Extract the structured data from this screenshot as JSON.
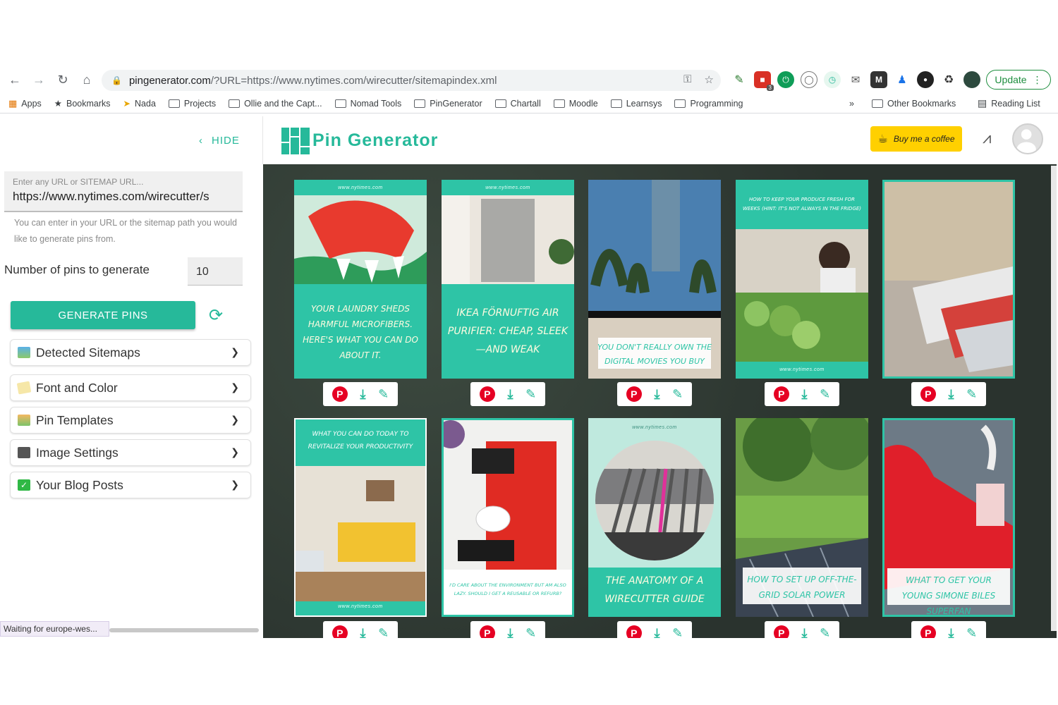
{
  "browser": {
    "url_host": "pingenerator.com",
    "url_rest": "/?URL=https://www.nytimes.com/wirecutter/sitemapindex.xml",
    "update_label": "Update",
    "extension_badge": "3",
    "bookmarks": [
      "Apps",
      "Bookmarks",
      "Nada",
      "Projects",
      "Ollie and the Capt...",
      "Nomad Tools",
      "PinGenerator",
      "Chartall",
      "Moodle",
      "Learnsys",
      "Programming"
    ],
    "overflow": "»",
    "other_bookmarks": "Other Bookmarks",
    "reading_list": "Reading List"
  },
  "sidebar": {
    "hide_label": "HIDE",
    "url_placeholder": "Enter any URL or SITEMAP URL...",
    "url_value": "https://www.nytimes.com/wirecutter/s",
    "url_hint": "You can enter in your URL or the sitemap path you would like to generate pins from.",
    "pins_label": "Number of pins to generate",
    "pins_value": "10",
    "generate_label": "GENERATE PINS",
    "accordions": [
      "Detected Sitemaps",
      "Font and Color",
      "Pin Templates",
      "Image Settings",
      "Your Blog Posts"
    ],
    "status": "Waiting for europe-wes..."
  },
  "header": {
    "app_title": "Pin Generator",
    "coffee_label": "Buy me a coffee"
  },
  "colors": {
    "accent": "#26b99a",
    "pinterest": "#e60023",
    "coffee": "#ffd000"
  },
  "pins": [
    {
      "site": "www.nytimes.com",
      "caption": "Your laundry sheds harmful microfibers. Here's what you can do about it."
    },
    {
      "site": "www.nytimes.com",
      "caption": "IKEA Förnuftig Air Purifier: Cheap, Sleek—and Weak"
    },
    {
      "caption": "You don't really own the digital movies you buy"
    },
    {
      "caption": "How to keep your produce fresh for weeks (hint: it's not always in the fridge)",
      "site": "www.nytimes.com"
    },
    {
      "caption": ""
    },
    {
      "caption": "What you can do today to revitalize your productivity",
      "site": "www.nytimes.com"
    },
    {
      "caption": "I'd care about the environment but am also lazy. Should I get a reusable or refurb?"
    },
    {
      "site": "www.nytimes.com",
      "caption": "The Anatomy of a Wirecutter Guide"
    },
    {
      "caption": "How to set up off-the-grid solar power"
    },
    {
      "caption": "What to get your young Simone Biles superfan"
    }
  ]
}
